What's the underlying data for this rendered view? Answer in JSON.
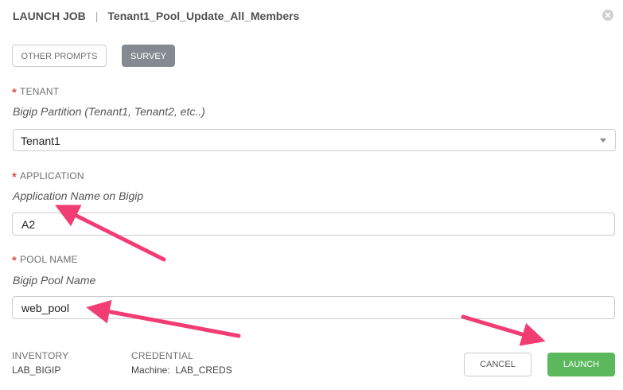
{
  "header": {
    "title": "LAUNCH JOB",
    "separator": "|",
    "job_name": "Tenant1_Pool_Update_All_Members"
  },
  "tabs": {
    "other_prompts": "OTHER PROMPTS",
    "survey": "SURVEY"
  },
  "fields": {
    "tenant": {
      "required_mark": "*",
      "label": "TENANT",
      "description": "Bigip Partition (Tenant1, Tenant2, etc..)",
      "value": "Tenant1"
    },
    "application": {
      "required_mark": "*",
      "label": "APPLICATION",
      "description": "Application Name on Bigip",
      "value": "A2"
    },
    "pool_name": {
      "required_mark": "*",
      "label": "POOL NAME",
      "description": "Bigip Pool Name",
      "value": "web_pool"
    }
  },
  "footer": {
    "inventory_label": "INVENTORY",
    "inventory_value": "LAB_BIGIP",
    "credential_label": "CREDENTIAL",
    "credential_value": "Machine:  LAB_CREDS",
    "cancel_label": "CANCEL",
    "launch_label": "LAUNCH"
  },
  "colors": {
    "accent_arrow": "#f23d74",
    "launch_green": "#5cb85c",
    "survey_tab": "#848992",
    "required_red": "#d9534f"
  },
  "icons": {
    "close": "close-circle-icon",
    "caret": "caret-down-icon"
  }
}
